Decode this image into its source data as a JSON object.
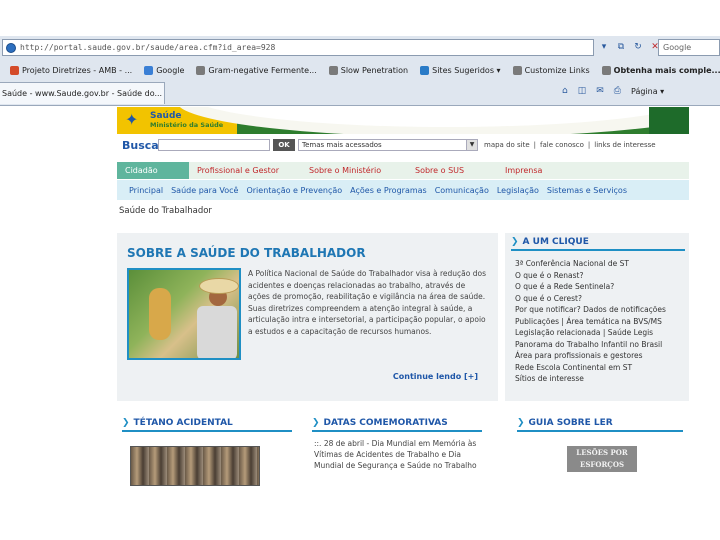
{
  "browser": {
    "address": "http://portal.saude.gov.br/saude/area.cfm?id_area=928",
    "search_placeholder": "Google",
    "favorites": [
      {
        "label": "Projeto Diretrizes - AMB - ...",
        "color": "#d44b2a",
        "bold": false
      },
      {
        "label": "Google",
        "color": "#3a7fd5",
        "bold": false
      },
      {
        "label": "Gram-negative Fermente...",
        "color": "#7a7a7a",
        "bold": false
      },
      {
        "label": "Slow Penetration",
        "color": "#7a7a7a",
        "bold": false
      },
      {
        "label": "Sites Sugeridos ▾",
        "color": "#2a7bc7",
        "bold": false
      },
      {
        "label": "Customize Links",
        "color": "#7a7a7a",
        "bold": false
      },
      {
        "label": "Obtenha mais comple...",
        "color": "#7a7a7a",
        "bold": true
      }
    ],
    "tab_title": "Saúde - www.Saude.gov.br - Saúde do...",
    "page_tool": "Página ▾"
  },
  "site": {
    "logo_title": "Saúde",
    "logo_sub": "Ministério da Saúde",
    "busca_label": "Busca",
    "ok_label": "OK",
    "temas_select": "Temas mais acessados",
    "top_links": [
      "mapa do site",
      "|",
      "fale conosco",
      "|",
      "links de interesse"
    ],
    "main_nav": [
      {
        "label": "Cidadão",
        "active": true
      },
      {
        "label": "Profissional e Gestor",
        "active": false
      },
      {
        "label": "Sobre o Ministério",
        "active": false
      },
      {
        "label": "Sobre o SUS",
        "active": false
      },
      {
        "label": "Imprensa",
        "active": false
      }
    ],
    "sub_nav": [
      "Principal",
      "Saúde para Você",
      "Orientação e Prevenção",
      "Ações e Programas",
      "Comunicação",
      "Legislação",
      "Sistemas e Serviços"
    ],
    "breadcrumb": "Saúde do Trabalhador",
    "sobre": {
      "title": "SOBRE A SAÚDE DO TRABALHADOR",
      "text": "A Política Nacional de Saúde do Trabalhador visa à redução dos acidentes e doenças relacionadas ao trabalho, através de ações de promoção, reabilitação e vigilância na área de saúde. Suas diretrizes compreendem a atenção integral à saúde, a articulação intra e intersetorial, a participação popular, o apoio a estudos e a capacitação de recursos humanos.",
      "continue": "Continue lendo [+]"
    },
    "clique": {
      "title": "A UM CLIQUE",
      "items": [
        "3ª Conferência Nacional de ST",
        "O que é o Renast?",
        "O que é a Rede Sentinela?",
        "O que é o Cerest?",
        "Por que notificar? Dados de notificações",
        "Publicações | Área temática na BVS/MS",
        "Legislação relacionada | Saúde Legis",
        "Panorama do Trabalho Infantil no Brasil",
        "Área para profissionais e gestores",
        "Rede Escola Continental em ST",
        "Sítios de interesse"
      ]
    },
    "tetano": {
      "title": "TÉTANO ACIDENTAL"
    },
    "datas": {
      "title": "DATAS COMEMORATIVAS",
      "text": "::. 28 de abril - Dia Mundial em Memória às Vítimas de Acidentes de Trabalho e Dia Mundial de Segurança e Saúde no Trabalho"
    },
    "guia": {
      "title": "GUIA SOBRE LER",
      "image_text": "LESÕES POR ESFORÇOS"
    }
  }
}
